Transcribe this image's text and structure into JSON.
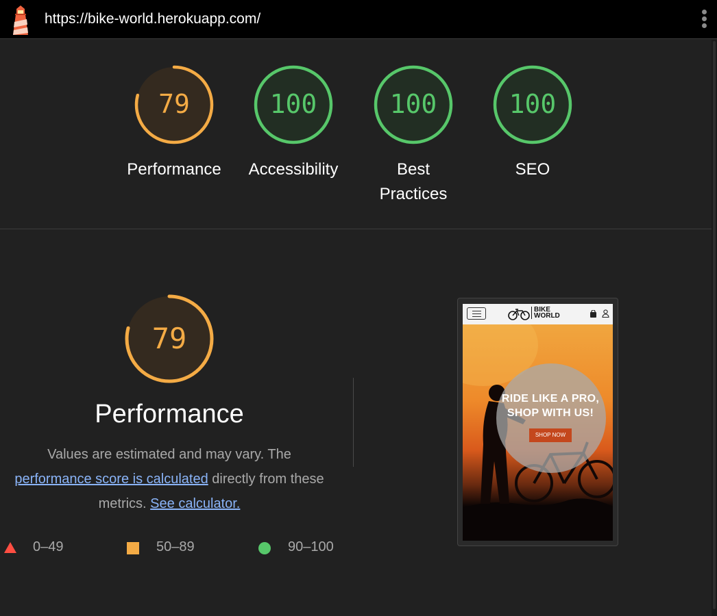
{
  "topbar": {
    "url": "https://bike-world.herokuapp.com/",
    "logo_icon": "lighthouse-icon",
    "menu_icon": "kebab-menu-icon"
  },
  "colors": {
    "pass": "#0cce6b",
    "pass_ring": "#57c76a",
    "average": "#ffa400",
    "average_ring": "#f4ab45",
    "fail": "#ff4e42",
    "link": "#8ab4f8"
  },
  "gauges": [
    {
      "label": "Performance",
      "score": "79",
      "rating": "average"
    },
    {
      "label": "Accessibility",
      "score": "100",
      "rating": "pass"
    },
    {
      "label_line1": "Best",
      "label_line2": "Practices",
      "score": "100",
      "rating": "pass"
    },
    {
      "label": "SEO",
      "score": "100",
      "rating": "pass"
    }
  ],
  "performance": {
    "score": "79",
    "title": "Performance",
    "desc_text1": "Values are estimated and may vary. The ",
    "desc_link1": "performance score is calculated",
    "desc_text2": " directly from these metrics. ",
    "desc_link2": "See calculator.",
    "legend": [
      {
        "shape": "triangle",
        "range": "0–49"
      },
      {
        "shape": "square",
        "range": "50–89"
      },
      {
        "shape": "circle",
        "range": "90–100"
      }
    ]
  },
  "thumbnail": {
    "brand_line1": "BIKE",
    "brand_line2": "WORLD",
    "hero_line1": "RIDE LIKE A PRO,",
    "hero_line2": "SHOP WITH US!",
    "button": "SHOP NOW",
    "icons": [
      "hamburger-menu-icon",
      "bicycle-logo-icon",
      "shopping-bag-icon",
      "user-icon"
    ]
  }
}
